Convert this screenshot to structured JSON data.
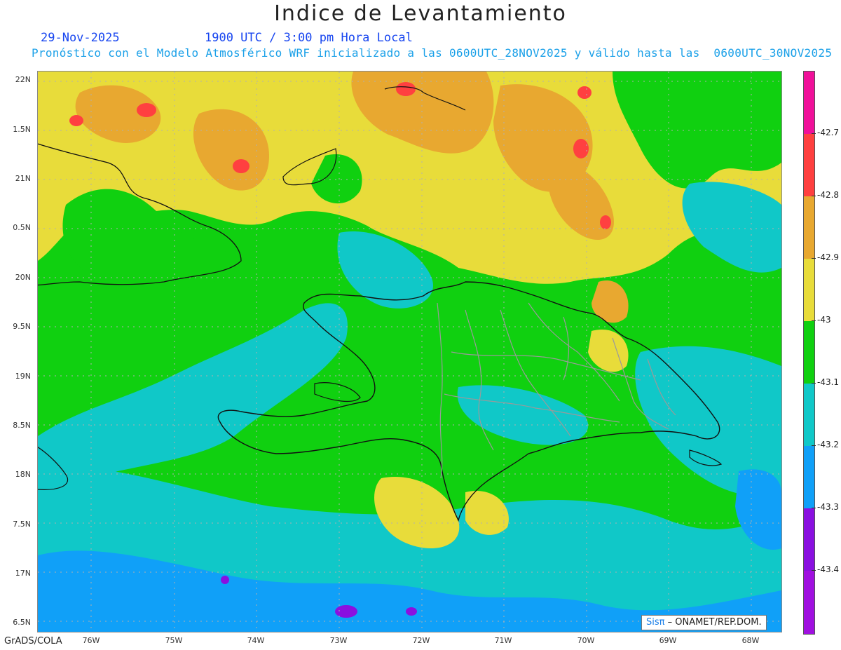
{
  "header": {
    "title": "Indice de Levantamiento",
    "date": "29-Nov-2025",
    "time": "1900 UTC / 3:00 pm Hora Local",
    "model_line": "Pronóstico con el Modelo Atmosférico WRF inicializado a las 0600UTC_28NOV2025 y válido hasta las  0600UTC_30NOV2025"
  },
  "map": {
    "lat_labels": [
      "22N",
      "1.5N",
      "21N",
      "0.5N",
      "20N",
      "9.5N",
      "19N",
      "8.5N",
      "18N",
      "7.5N",
      "17N",
      "6.5N"
    ],
    "lon_labels": [
      "76W",
      "75W",
      "74W",
      "73W",
      "72W",
      "71W",
      "70W",
      "69W",
      "68W"
    ],
    "field_colors": {
      "magenta": "#f0109a",
      "red": "#ff4040",
      "orange": "#e8a830",
      "yellow": "#e8dc3a",
      "green": "#10d010",
      "cyan": "#10c8c8",
      "blue": "#10a0f8",
      "purple": "#8a10e0",
      "violet": "#a010e0"
    }
  },
  "colorbar": {
    "labels": [
      "-42.7",
      "-42.8",
      "-42.9",
      "-43",
      "-43.1",
      "-43.2",
      "-43.3",
      "-43.4"
    ],
    "colors": [
      "#f0109a",
      "#ff4040",
      "#e8a830",
      "#e8dc3a",
      "#10d010",
      "#10c8c8",
      "#10a0f8",
      "#8a10e0",
      "#a010e0"
    ]
  },
  "footer": {
    "credit_sis": "Sisπ",
    "credit_org": "– ONAMET/REP.DOM.",
    "software": "GrADS/COLA"
  }
}
